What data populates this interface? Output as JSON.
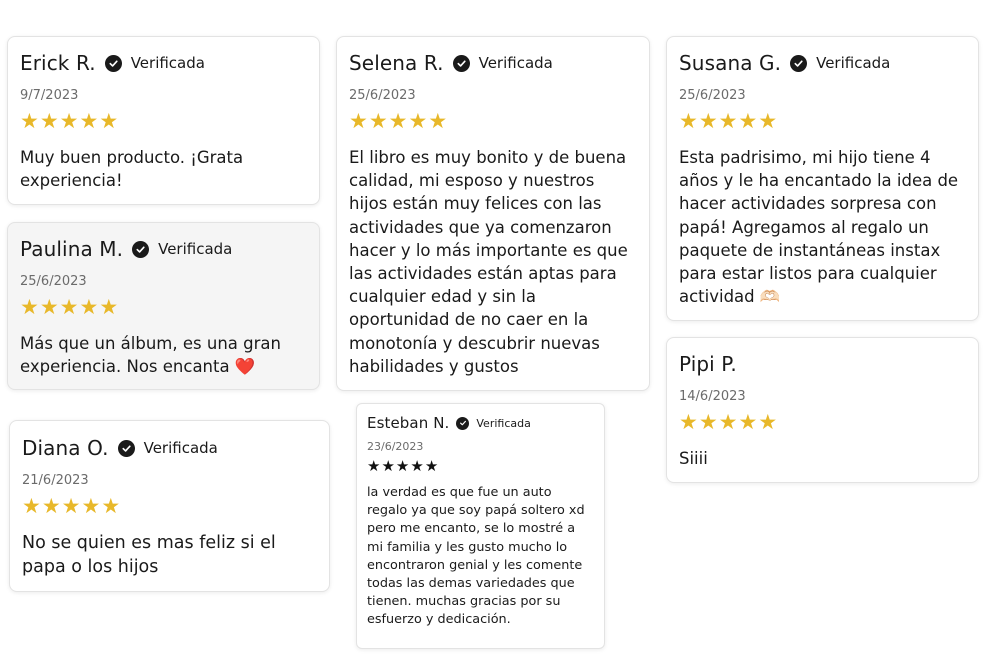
{
  "colors": {
    "star": "#e8b82a",
    "star_dark": "#111111",
    "heart": "#e0242d"
  },
  "icons": {
    "verified": "check-circle-icon",
    "rating": "star-icon",
    "emoji_heart": "heart-icon",
    "emoji_hands": "heart-hands-icon"
  },
  "reviews": [
    {
      "name": "Erick R.",
      "verified": "Verificada",
      "date": "9/7/2023",
      "rating": 5,
      "text": "Muy buen producto. ¡Grata experiencia!"
    },
    {
      "name": "Paulina M.",
      "verified": "Verificada",
      "date": "25/6/2023",
      "rating": 5,
      "text": "Más que un álbum, es una gran experiencia. Nos encanta",
      "emoji": "❤️"
    },
    {
      "name": "Diana O.",
      "verified": "Verificada",
      "date": "21/6/2023",
      "rating": 5,
      "text": "No se quien es mas feliz si el papa o los hijos"
    },
    {
      "name": "Selena R.",
      "verified": "Verificada",
      "date": "25/6/2023",
      "rating": 5,
      "text": "El libro es muy bonito y de buena calidad, mi esposo y nuestros hijos están muy felices con las actividades que ya comenzaron hacer y lo más importante es que las actividades están aptas para cualquier edad y sin la oportunidad de no caer en la monotonía y descubrir nuevas habilidades y gustos"
    },
    {
      "name": "Esteban N.",
      "verified": "Verificada",
      "date": "23/6/2023",
      "rating": 5,
      "text": "la verdad es que fue un auto regalo ya que soy papá soltero xd pero me encanto, se lo mostré a mi familia y les gusto mucho lo encontraron genial y les comente todas las demas variedades que tienen. muchas gracias por su esfuerzo y dedicación."
    },
    {
      "name": "Susana G.",
      "verified": "Verificada",
      "date": "25/6/2023",
      "rating": 5,
      "text": "Esta padrisimo, mi hijo tiene 4 años y le ha encantado la idea de hacer actividades sorpresa con papá! Agregamos al regalo un paquete de instantáneas instax para estar listos para cualquier actividad",
      "emoji": "🫶🏻"
    },
    {
      "name": "Pipi P.",
      "date": "14/6/2023",
      "rating": 5,
      "text": "Siiii"
    }
  ]
}
